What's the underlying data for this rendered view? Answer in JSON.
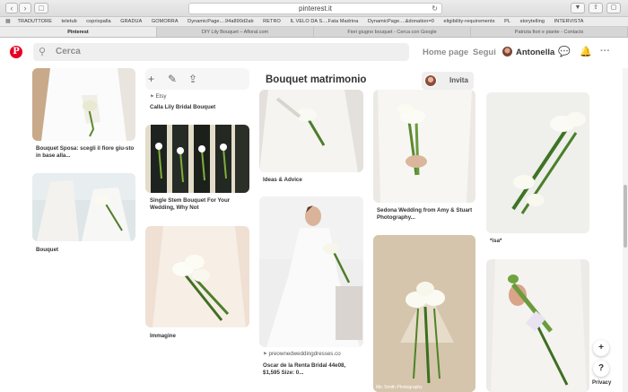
{
  "browser": {
    "url": "pinterest.it",
    "bookmarks": [
      "TRADUTTORE",
      "teletub",
      "coprispalla",
      "GRADUA",
      "GOMORRA",
      "DynamicPage....94a890d2ab",
      "IL VELO DA S....Fata Madrina",
      "RETRO",
      "DynamicPage....&donation=0",
      "eligibility-requirements",
      "PL",
      "storytelling",
      "INTERVISTA"
    ],
    "tabs": [
      "Pinterest",
      "DIY Lily Bouquet – Afloral.com",
      "Fiori giugno bouquet - Cerca con Google",
      "Patrizia fiori e piante - Contacts"
    ]
  },
  "header": {
    "search_placeholder": "Cerca",
    "home_label": "Home page",
    "follow_label": "Segui",
    "user_name": "Antonella"
  },
  "board": {
    "title": "Bouquet matrimonio",
    "invite_label": "Invita"
  },
  "pins": {
    "p1_title": "Bouquet Sposa: scegli il fiore giu-sto in base alla...",
    "p2_title": "Bouquet",
    "p3_source": "Etsy",
    "p3_title": "Calla Lily Bridal Bouquet",
    "p4_title": "Single Stem Bouquet For Your Wedding, Why Not",
    "p5_title": "Immagine",
    "p6_title": "Ideas & Advice",
    "p7_source": "preownedweddingdresses.co",
    "p7_title": "Oscar de la Renta Bridal 44e08, $1,595 Size: 0...",
    "p8_title": "Sedona Wedding from Amy & Stuart Photography...",
    "p9_caption": "Mic Smith Photography",
    "p10_title": "*isa*"
  },
  "floating": {
    "add_label": "+",
    "help_label": "?",
    "privacy_label": "Privacy"
  },
  "colors": {
    "brand": "#e60023",
    "text": "#333333",
    "muted": "#8e8e8e"
  }
}
